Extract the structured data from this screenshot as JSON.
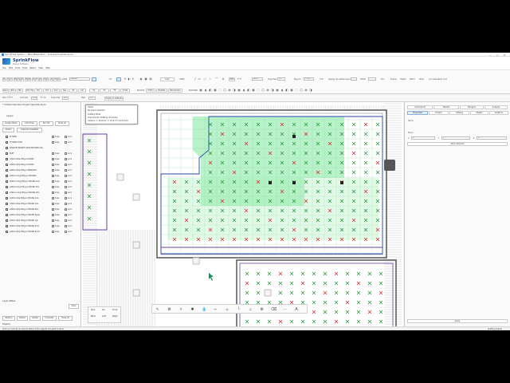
{
  "window": {
    "title": "SprinkFlow System — Basic/Basement — Licensed to James Quinn",
    "controls": [
      "—",
      "□",
      "✕"
    ]
  },
  "brand": {
    "name": "SprinkFlow",
    "subtitle": "Design Software"
  },
  "menu": [
    "File",
    "Edit",
    "Tools",
    "Tools",
    "Select",
    "View",
    "Help"
  ],
  "ribbon": {
    "row1_left": [
      "RSJ",
      "Hgr",
      "Cnt",
      "Mtr",
      "Pipe",
      "Dim",
      "Fittings",
      "Run",
      "Var",
      "Hd",
      "Sprk",
      "Tbl",
      "Linkd",
      "Align",
      "Shr",
      "Grp"
    ],
    "layer_label": "LAYER",
    "layer_value": "Default",
    "fill_label": "Fill",
    "color_label": "Color",
    "lines_label": "LINES",
    "hatch_label": "HATCH",
    "hatch_value": "Solid",
    "snap_label": "Snap Max",
    "snap_value": "5.0",
    "beyond_label": "Beyond",
    "beyond_value": "1 1/2...",
    "thin_label": "Thin",
    "display_label": "Display all visible layers",
    "offset_label": "Offset",
    "errs": [
      "Errs",
      "Events",
      "Halted",
      "Metric",
      "Walls",
      "Conceptual",
      "Auto Grid"
    ],
    "row2_left": [
      "Dim Cal",
      "Box",
      "Mtl"
    ],
    "row2": [
      "Dim-Ft",
      "Ctrl",
      "Chk",
      "Grid",
      "Tee",
      "Pk",
      "Cpl"
    ],
    "row2_mid": [
      "FA",
      "FS",
      "FP",
      "F. Fab"
    ],
    "blocks_label": "BLOCKS",
    "blocks": [
      "Orifice",
      "Modifier",
      "Benchmark"
    ],
    "building_label": "BUILDING",
    "row3": [
      "Size: 17.37",
      "Grid size",
      "15.0",
      "Fr. Clr.",
      "Snap Size",
      "6.0"
    ],
    "row3_r": [
      "Pipe",
      "1.0",
      "Display & Defaults"
    ]
  },
  "left_panel": {
    "project_title": "* Untitled Sprinkler Project (Sprinkle Sure)",
    "layers_label": "Layers",
    "buttons": [
      "Design Mode",
      "Click Hide",
      "Dim 3D",
      "Show All"
    ],
    "order_label": "Orders",
    "organize_label": "Organize Classified",
    "groups": [
      {
        "name": "FP SPRK",
        "snap": "Snap",
        "lock": "Lock"
      },
      {
        "name": "FP SPRK COVR",
        "snap": "Snap",
        "lock": "Lock"
      }
    ],
    "background_group": "SHADOW PROJECT BACKGROUND (26)",
    "layers": [
      "SKET",
      "A226-In-Plan Bldg-A DOORS",
      "A226-In-Plan Bldg-A DOORS",
      "A226-In-Plan Bldg-A WINDOWS",
      "A226-In-Clng-Pltng-A CEILINGS",
      "A226-In-Clng-Pltng-A CEILING-Grid",
      "A226-In-Clng Pltng-A CEILING Ctrs",
      "A226-In-Clng-Pltng-A CEILING Ctrs",
      "A226-In-Plan Bldg-A CEILING Cols",
      "A226-In-Plan Bldg-A CEILING Ctrs",
      "A226-In-Plan Bldg-A CEILING Elev",
      "A226-In-Plan Bldg-A CEILING Equip",
      "A226-In-Plan Bldg-A CEILING Lgt",
      "A226-In-Plan Bldg-A CEILING Prod",
      "A226-In-Plan Bldg-A CEILING Room"
    ],
    "layer_states_label": "Layer States",
    "save_label": "Save",
    "bottom_buttons": [
      "Restore",
      "Delete",
      "Isolate",
      "Unisolate",
      "Show All"
    ],
    "objects_label": "Objects",
    "selection_label": "Selection"
  },
  "tooltip": {
    "lines": [
      "Select",
      "No object selected",
      "Drafting Mode",
      "Snap Herald: Drafting (at points)",
      "Camera: 1, 10.0,0.0  /  7.3,0.0,7.0  1.0,0.0,0.0"
    ]
  },
  "right_panel": {
    "tabs_row1": [
      "Commands",
      "Selects",
      "Hangers",
      "Analyze"
    ],
    "tabs_row2": [
      "Properties",
      "Project",
      "Catalog",
      "Sheets",
      "Graphics"
    ],
    "name_label": "Name",
    "move_label": "Move",
    "x_label": "X",
    "x_value": "0",
    "y_label": "Y",
    "y_value": "0",
    "z_label": "Z",
    "z_value": "0",
    "move_selected": "Move Selected",
    "apply": "Apply"
  },
  "nav": [
    "Plan",
    "Iso",
    "Front",
    "Back",
    "Left",
    "Right"
  ],
  "float_toolbar_icons": [
    "cursor",
    "gear",
    "bolt",
    "sprinkler",
    "water",
    "pipe",
    "tee",
    "elbow",
    "hanger",
    "valve",
    "eraser",
    "more",
    "text"
  ],
  "status": {
    "left": "Click a or specify an area to define a the magnet not select a bend",
    "right": "Drafting Output"
  },
  "colors": {
    "accent": "#2a7fd4",
    "grid_highlight": "#7be89a",
    "wall_purple": "#6a3fa8",
    "wall_blue": "#2244aa",
    "sprinkler_x_red": "#d63030",
    "sprinkler_x_green": "#2a9a3a"
  }
}
